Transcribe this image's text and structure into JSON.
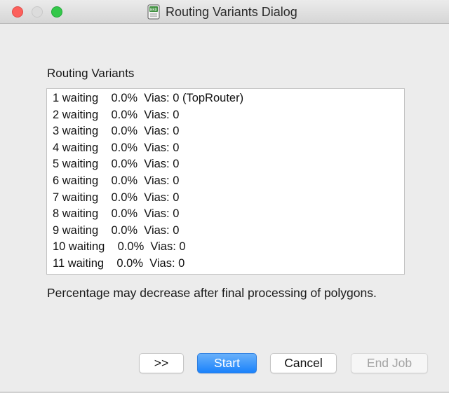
{
  "window": {
    "title": "Routing Variants Dialog",
    "app_icon": "board-document-icon"
  },
  "colors": {
    "close": "#fc605c",
    "minimize": "#dcdcdc",
    "maximize": "#34c84a",
    "primary_button": "#1a82fb"
  },
  "main": {
    "section_label": "Routing Variants",
    "variants": [
      {
        "text": "1 waiting    0.0%  Vias: 0 (TopRouter)"
      },
      {
        "text": "2 waiting    0.0%  Vias: 0"
      },
      {
        "text": "3 waiting    0.0%  Vias: 0"
      },
      {
        "text": "4 waiting    0.0%  Vias: 0"
      },
      {
        "text": "5 waiting    0.0%  Vias: 0"
      },
      {
        "text": "6 waiting    0.0%  Vias: 0"
      },
      {
        "text": "7 waiting    0.0%  Vias: 0"
      },
      {
        "text": "8 waiting    0.0%  Vias: 0"
      },
      {
        "text": "9 waiting    0.0%  Vias: 0"
      },
      {
        "text": "10 waiting    0.0%  Vias: 0"
      },
      {
        "text": "11 waiting    0.0%  Vias: 0"
      }
    ],
    "note": "Percentage may decrease after final processing of polygons."
  },
  "buttons": {
    "more_label": ">>",
    "start_label": "Start",
    "cancel_label": "Cancel",
    "end_job_label": "End Job"
  }
}
